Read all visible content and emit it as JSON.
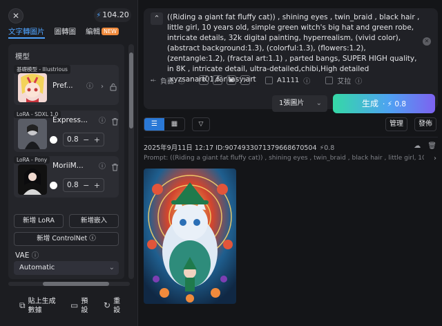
{
  "header": {
    "close_label": "✕",
    "credits": "104.20",
    "tabs": [
      {
        "label": "文字轉圖片",
        "active": true
      },
      {
        "label": "圖轉圖",
        "active": false
      },
      {
        "label": "編輯",
        "active": false,
        "badge": "NEW"
      }
    ]
  },
  "model_panel": {
    "section_title": "模型",
    "base_model": {
      "tag": "基礎模型 - Illustrious",
      "name": "Pref..."
    },
    "loras": [
      {
        "tag": "LoRA - SDXL 1.0",
        "name": "Express...",
        "weight": "0.8"
      },
      {
        "tag": "LoRA - Pony",
        "name": "MoriiM...",
        "weight": "0.8"
      }
    ],
    "add_lora": "新增 LoRA",
    "add_embedding": "新增嵌入",
    "add_controlnet": "新增 ControlNet",
    "vae_label": "VAE",
    "vae_value": "Automatic"
  },
  "bottom_actions": [
    {
      "label_line1": "貼上生成",
      "label_line2": "數據"
    },
    {
      "label_line1": "預",
      "label_line2": "設"
    },
    {
      "label_line1": "重",
      "label_line2": "設"
    }
  ],
  "prompt": {
    "text": "((Riding a giant fat fluffy cat)) , shining eyes , twin_braid , black hair , little girl, 10 years old, simple green witch's big hat and green robe, intricate details, 32k digital painting, hyperrealism, (vivid color),(abstract background:1.3), (colorful:1.3), (flowers:1.2), (zentangle:1.2), (fractal art:1.1) , parted bangs, SUPER HIGH quality, in 8K , intricate detail, ultra-detailed,chibi,High detailed ,xyzsanart01,fantasy,art",
    "negative_label": "負面",
    "a1111_label": "A1111",
    "style_label": "艾拉"
  },
  "generate": {
    "count_label": "1張圖片",
    "button_label": "生成",
    "cost": "0.8"
  },
  "history": {
    "manage_label": "管理",
    "publish_label": "發佈",
    "record_header": "2025年9月11日 12:17 ID:907493307137966867050​4",
    "record_cost": "0.8",
    "prompt_preview": "Prompt: ((Riding a giant fat fluffy cat)) , shining eyes , twin_braid , black hair , little girl, 10 years old, simple..."
  },
  "colors": {
    "accent": "#4fa3ff",
    "generate_gradient": [
      "#35d9a6",
      "#4ea2f2",
      "#7d62f0"
    ],
    "badge_new": "#f08a3c"
  }
}
